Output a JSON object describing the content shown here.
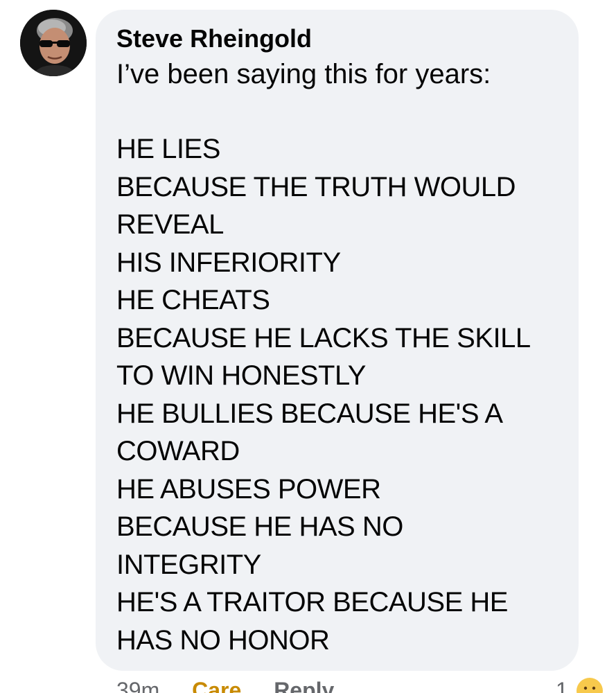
{
  "comment": {
    "author": "Steve Rheingold",
    "intro": "I’ve been saying this for years:",
    "lines": [
      "HE LIES",
      "BECAUSE THE TRUTH WOULD",
      "REVEAL",
      "HIS INFERIORITY",
      "HE CHEATS",
      "BECAUSE HE LACKS THE SKILL",
      "TO WIN HONESTLY",
      "HE BULLIES BECAUSE HE'S A",
      "COWARD",
      "HE ABUSES POWER",
      "BECAUSE HE HAS NO",
      "INTEGRITY",
      "HE'S A TRAITOR BECAUSE HE",
      "HAS NO HONOR"
    ]
  },
  "actions": {
    "time": "39m",
    "care_label": "Care",
    "reply_label": "Reply",
    "reaction_count": "1"
  },
  "colors": {
    "bubble": "#f0f2f5",
    "text": "#050505",
    "meta": "#65676b",
    "care": "#c88a00"
  },
  "icons": {
    "reaction": "care-emoji-icon"
  }
}
